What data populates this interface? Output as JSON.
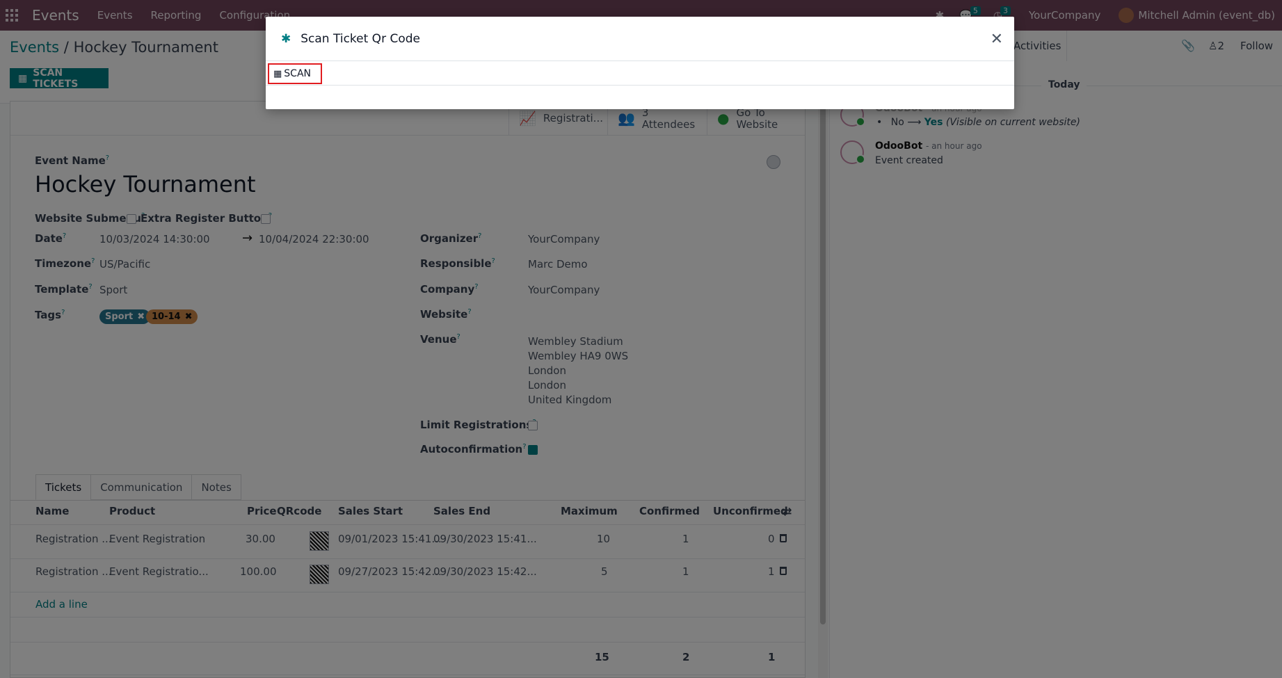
{
  "nav": {
    "brand": "Events",
    "menu": [
      "Events",
      "Reporting",
      "Configuration"
    ],
    "chat_count": "5",
    "activity_count": "3",
    "company": "YourCompany",
    "user": "Mitchell Admin (event_db)"
  },
  "breadcrumb": {
    "parent": "Events",
    "sep": "/",
    "current": "Hockey Tournament"
  },
  "actions": {
    "scan_tickets": "SCAN TICKETS"
  },
  "stats": {
    "registrations": "Registrati...",
    "attendees_count": "3",
    "attendees": "Attendees",
    "website_1": "Go To",
    "website_2": "Website"
  },
  "form": {
    "event_name_label": "Event Name",
    "event_name": "Hockey Tournament",
    "website_submenu": "Website Submenu",
    "extra_register": "Extra Register Button",
    "date_label": "Date",
    "date_start": "10/03/2024 14:30:00",
    "date_end": "10/04/2024 22:30:00",
    "timezone_label": "Timezone",
    "timezone": "US/Pacific",
    "template_label": "Template",
    "template": "Sport",
    "tags_label": "Tags",
    "tags": [
      {
        "name": "Sport",
        "color": "#25748f"
      },
      {
        "name": "10-14",
        "color": "#d08a4a"
      }
    ],
    "organizer_label": "Organizer",
    "organizer": "YourCompany",
    "responsible_label": "Responsible",
    "responsible": "Marc Demo",
    "company_label": "Company",
    "company": "YourCompany",
    "website_label": "Website",
    "venue_label": "Venue",
    "venue": [
      "Wembley Stadium",
      "Wembley HA9 0WS",
      "London",
      "London",
      "United Kingdom"
    ],
    "limit_label": "Limit Registrations",
    "autoconfirm_label": "Autoconfirmation"
  },
  "tabs": [
    "Tickets",
    "Communication",
    "Notes"
  ],
  "table": {
    "headers": {
      "name": "Name",
      "product": "Product",
      "price": "Price",
      "qrcode": "QRcode",
      "sales_start": "Sales Start",
      "sales_end": "Sales End",
      "maximum": "Maximum",
      "confirmed": "Confirmed",
      "unconfirmed": "Unconfirmed"
    },
    "rows": [
      {
        "name": "Registration ...",
        "product": "Event Registration",
        "price": "30.00",
        "sales_start": "09/01/2023 15:41...",
        "sales_end": "09/30/2023 15:41...",
        "maximum": "10",
        "confirmed": "1",
        "unconfirmed": "0"
      },
      {
        "name": "Registration ...",
        "product": "Event Registratio...",
        "price": "100.00",
        "sales_start": "09/27/2023 15:42...",
        "sales_end": "09/30/2023 15:42...",
        "maximum": "5",
        "confirmed": "1",
        "unconfirmed": "1"
      }
    ],
    "add_line": "Add a line",
    "totals": {
      "maximum": "15",
      "confirmed": "2",
      "unconfirmed": "1"
    }
  },
  "chatter": {
    "activities": "Activities",
    "followers": "2",
    "follow": "Follow",
    "today": "Today",
    "msg1": {
      "author": "OdooBot",
      "time": "- an hour ago",
      "old": "No",
      "arrow": "⟶",
      "new": "Yes",
      "note": "(Visible on current website)"
    },
    "msg2": {
      "author": "OdooBot",
      "time": "- an hour ago",
      "body": "Event created"
    }
  },
  "modal": {
    "title": "Scan Ticket Qr Code",
    "scan": "SCAN"
  }
}
